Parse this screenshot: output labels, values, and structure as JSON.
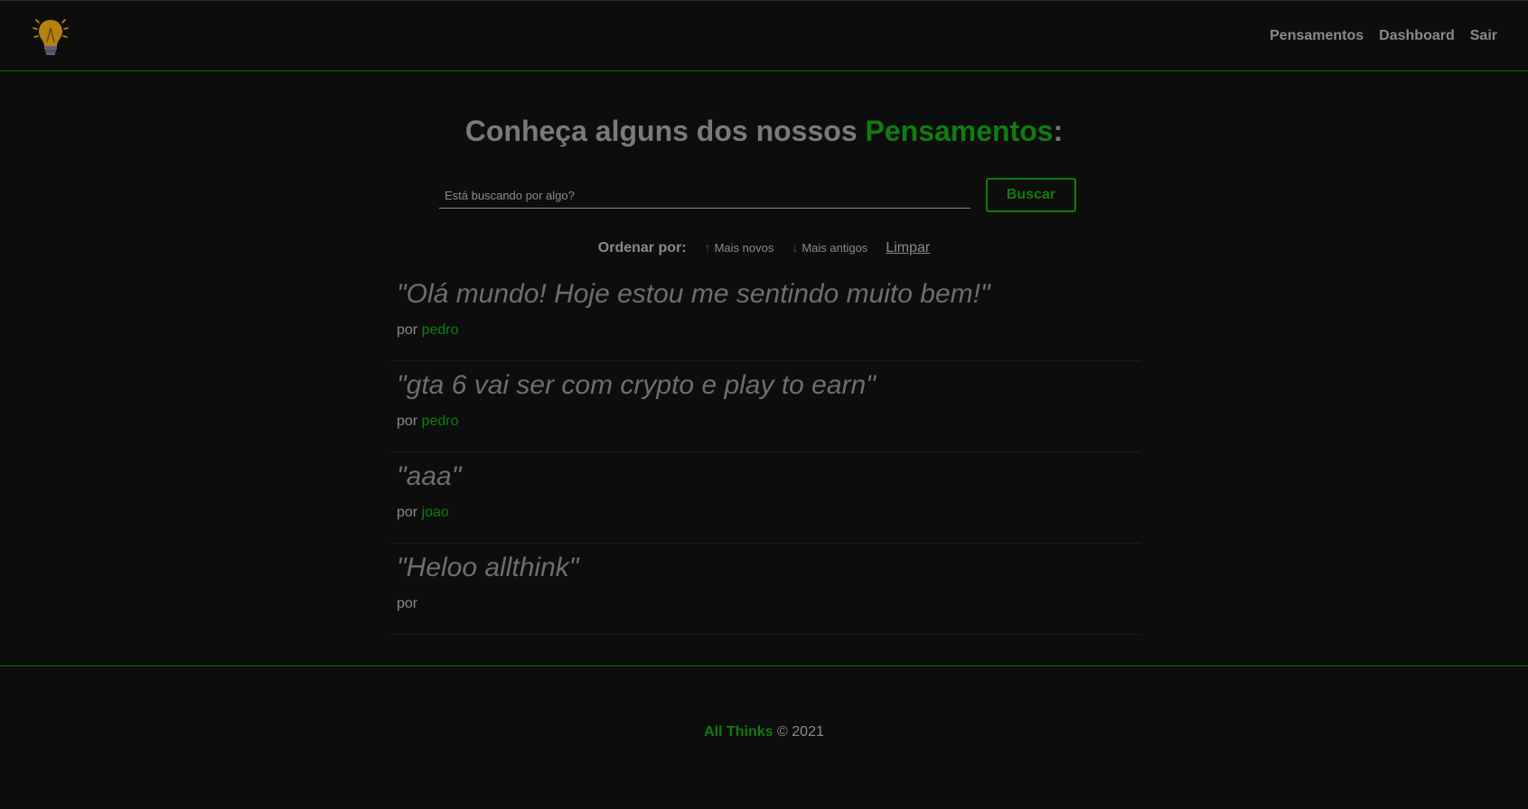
{
  "nav": {
    "logo_icon": "lightbulb-icon",
    "links": [
      {
        "label": "Pensamentos"
      },
      {
        "label": "Dashboard"
      },
      {
        "label": "Sair"
      }
    ]
  },
  "main": {
    "title_prefix": "Conheça alguns dos nossos ",
    "title_accent": "Pensamentos",
    "title_suffix": ":",
    "search": {
      "placeholder": "Está buscando por algo?",
      "value": "",
      "button_label": "Buscar"
    },
    "order": {
      "label": "Ordenar por:",
      "newest_icon": "arrow-up-icon",
      "newest_label": "Mais novos",
      "oldest_icon": "arrow-down-icon",
      "oldest_label": "Mais antigos",
      "clear_label": "Limpar"
    },
    "thoughts": [
      {
        "text": "\"Olá mundo! Hoje estou me sentindo muito bem!\"",
        "by": "por",
        "author": "pedro"
      },
      {
        "text": "\"gta 6 vai ser com crypto e play to earn\"",
        "by": "por",
        "author": "pedro"
      },
      {
        "text": "\"aaa\"",
        "by": "por",
        "author": "joao"
      },
      {
        "text": "\"Heloo allthink\"",
        "by": "por",
        "author": ""
      }
    ]
  },
  "footer": {
    "brand": "All Thinks",
    "copyright": "© 2021"
  },
  "colors": {
    "background": "#0d0d0d",
    "accent": "#107c10",
    "text": "#8a8a8a",
    "logo_bulb": "#c8900e"
  }
}
